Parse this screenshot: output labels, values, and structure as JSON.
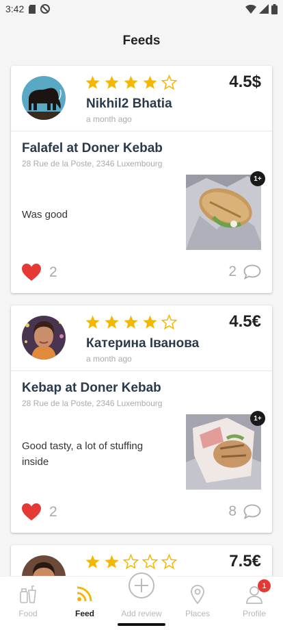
{
  "status_bar": {
    "time": "3:42"
  },
  "header": {
    "title": "Feeds"
  },
  "posts": [
    {
      "rating": 4,
      "price": "4.5$",
      "user": "Nikhil2 Bhatia",
      "time": "a month ago",
      "dish": "Falafel at Doner Kebab",
      "address": "28 Rue de la Poste, 2346 Luxembourg",
      "review": "Was good",
      "photo_badge": "1+",
      "likes": "2",
      "comments": "2"
    },
    {
      "rating": 4,
      "price": "4.5€",
      "user": "Катерина Іванова",
      "time": "a month ago",
      "dish": "Kebap at Doner Kebab",
      "address": "28 Rue de la Poste, 2346 Luxembourg",
      "review": "Good tasty, a lot of stuffing inside",
      "photo_badge": "1+",
      "likes": "2",
      "comments": "8"
    },
    {
      "rating": 2,
      "price": "7.5€"
    }
  ],
  "nav": {
    "food": "Food",
    "feed": "Feed",
    "add_review": "Add review",
    "places": "Places",
    "profile": "Profile",
    "profile_badge": "1"
  },
  "colors": {
    "star": "#f5b800",
    "heart": "#e53935",
    "feed_active": "#f5b800"
  }
}
